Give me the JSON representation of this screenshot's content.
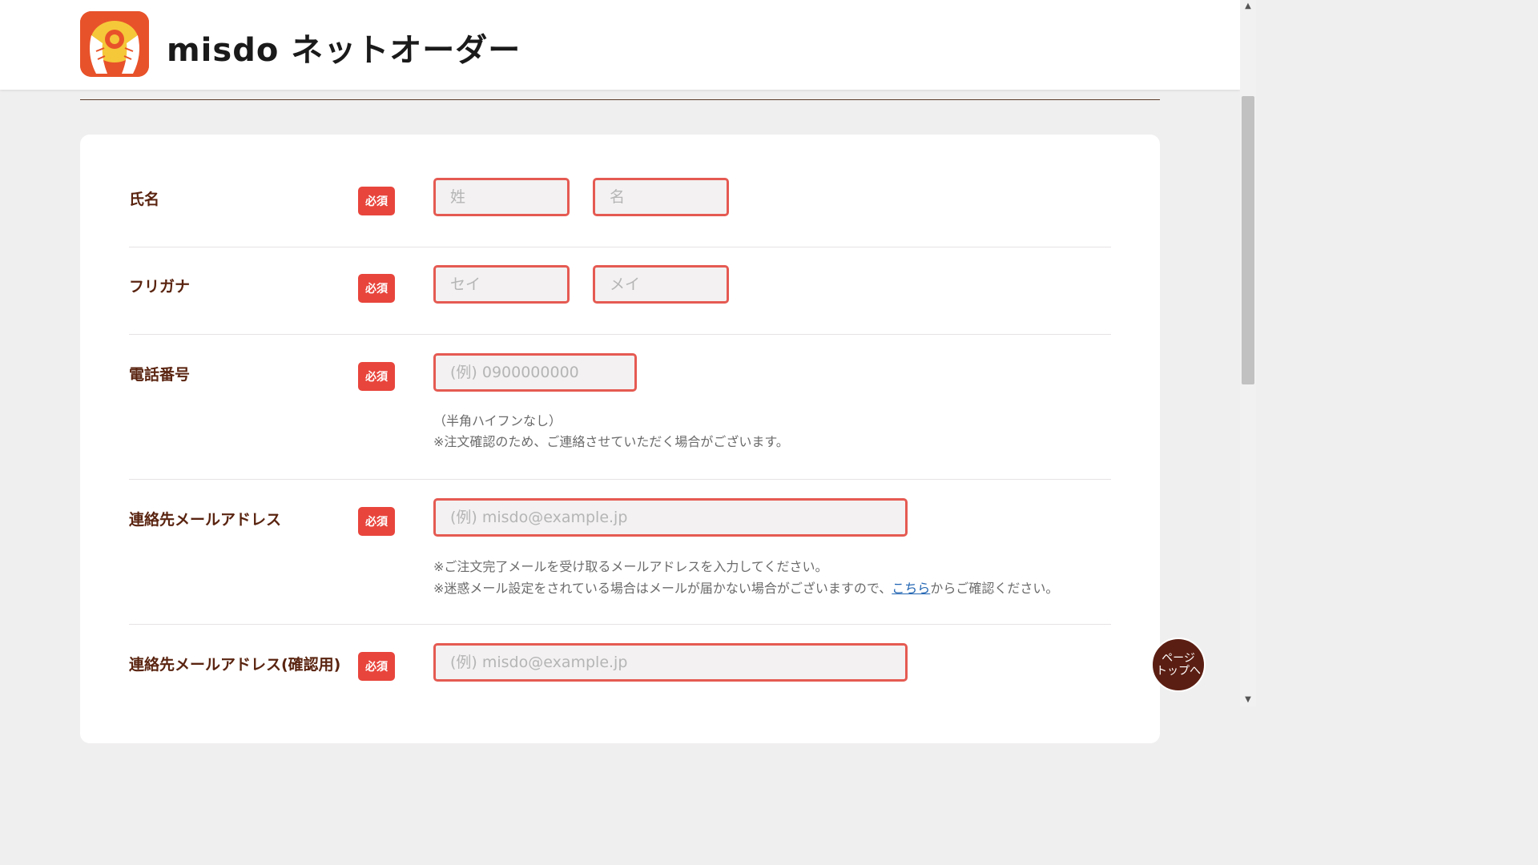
{
  "header": {
    "logo_icon": "donut-mascot-icon",
    "logo_text": "misdo ネットオーダー"
  },
  "form": {
    "required_badge": "必須",
    "name": {
      "label": "氏名",
      "last_placeholder": "姓",
      "first_placeholder": "名"
    },
    "furigana": {
      "label": "フリガナ",
      "last_placeholder": "セイ",
      "first_placeholder": "メイ"
    },
    "phone": {
      "label": "電話番号",
      "placeholder": "(例) 0900000000",
      "note1": "（半角ハイフンなし）",
      "note2": "※注文確認のため、ご連絡させていただく場合がございます。"
    },
    "email": {
      "label": "連絡先メールアドレス",
      "placeholder": "(例) misdo@example.jp",
      "note1": "※ご注文完了メールを受け取るメールアドレスを入力してください。",
      "note2_before": "※迷惑メール設定をされている場合はメールが届かない場合がございますので、",
      "note2_link": "こちら",
      "note2_after": "からご確認ください。"
    },
    "email_confirm": {
      "label": "連絡先メールアドレス(確認用)",
      "placeholder": "(例) misdo@example.jp"
    }
  },
  "page_top": {
    "line1": "ページ",
    "line2": "トップへ"
  },
  "colors": {
    "accent": "#e8453c",
    "brand_brown": "#5b1e12",
    "link": "#2366b3"
  }
}
